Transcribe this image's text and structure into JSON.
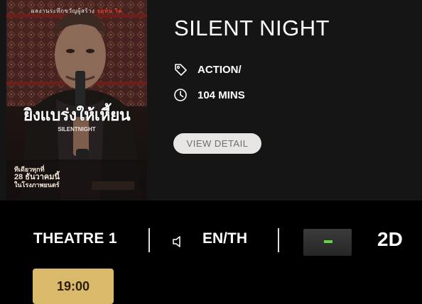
{
  "movie": {
    "title": "SILENT NIGHT",
    "genre": "ACTION/",
    "duration": "104 MINS",
    "view_detail_label": "VIEW DETAIL",
    "poster": {
      "topline_prefix": "ผลงานระทึกขวัญผู้สร้าง",
      "topline_accent": "จอห์น วิค",
      "title_th": "ยิงแบร่งให้เหี้ยน",
      "title_en": "SILENTNIGHT",
      "release_line1": "ทีเดียวทุกที่",
      "release_line2": "28 ธันวาคมนี้",
      "release_line3": "ในโรงภาพยนตร์"
    }
  },
  "session": {
    "theatre": "THEATRE 1",
    "language": "EN/TH",
    "dimension": "2D",
    "showtime": "19:00",
    "format_badge_color": "#62d63a"
  },
  "icons": {
    "genre": "tag-icon",
    "duration": "clock-icon",
    "language": "speaker-icon"
  },
  "colors": {
    "background": "#000000",
    "card": "#151515",
    "showtime_button": "#d9b96a",
    "view_detail_button": "#e7e6e4"
  }
}
